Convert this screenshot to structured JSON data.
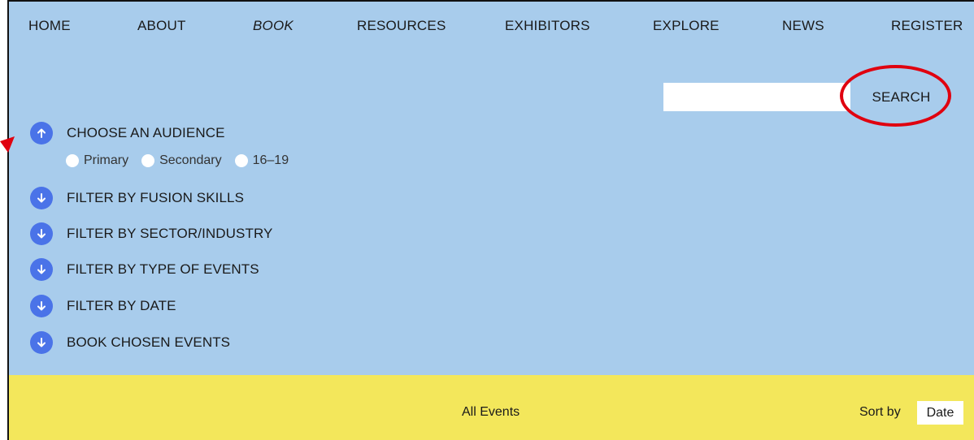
{
  "nav": {
    "items": [
      {
        "label": "HOME"
      },
      {
        "label": "ABOUT"
      },
      {
        "label": "BOOK"
      },
      {
        "label": "RESOURCES"
      },
      {
        "label": "EXHIBITORS"
      },
      {
        "label": "EXPLORE"
      },
      {
        "label": "NEWS"
      },
      {
        "label": "REGISTER"
      }
    ],
    "active": "BOOK"
  },
  "search": {
    "value": "",
    "placeholder": "",
    "button_label": "SEARCH"
  },
  "filters": {
    "audience": {
      "label": "CHOOSE AN AUDIENCE",
      "icon": "arrow-up-icon",
      "options": [
        "Primary",
        "Secondary",
        "16–19"
      ]
    },
    "items": [
      {
        "label": "FILTER BY FUSION SKILLS",
        "icon": "arrow-down-icon"
      },
      {
        "label": "FILTER BY SECTOR/INDUSTRY",
        "icon": "arrow-down-icon"
      },
      {
        "label": "FILTER BY TYPE OF EVENTS",
        "icon": "arrow-down-icon"
      },
      {
        "label": "FILTER BY DATE",
        "icon": "arrow-down-icon"
      },
      {
        "label": "BOOK CHOSEN EVENTS",
        "icon": "arrow-down-icon"
      }
    ]
  },
  "events_bar": {
    "title": "All Events",
    "sort_label": "Sort by",
    "sort_value": "Date"
  },
  "colors": {
    "panel_blue": "#a8ccec",
    "bar_yellow": "#f3e75b",
    "icon_blue": "#4a73e8",
    "annotation_red": "#e0000f"
  }
}
